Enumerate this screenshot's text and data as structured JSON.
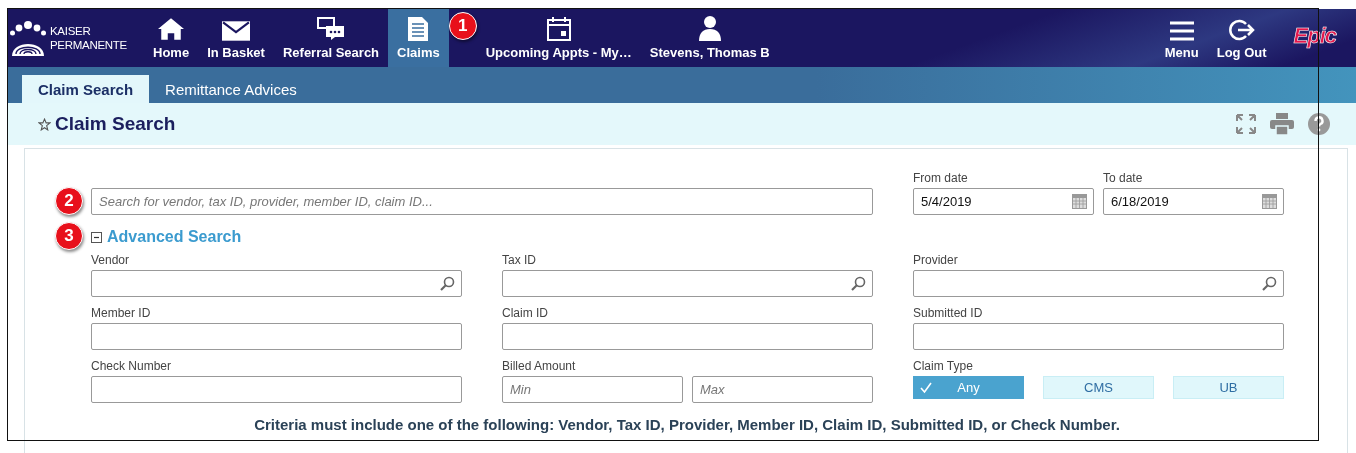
{
  "header": {
    "logo_lines": [
      "KAISER",
      "PERMANENTE"
    ],
    "nav": [
      {
        "label": "Home",
        "selected": false
      },
      {
        "label": "In Basket",
        "selected": false
      },
      {
        "label": "Referral Search",
        "selected": false
      },
      {
        "label": "Claims",
        "selected": true,
        "callout": "1"
      },
      {
        "label": "Upcoming Appts - My…",
        "selected": false
      },
      {
        "label": "Stevens, Thomas B",
        "selected": false
      }
    ],
    "right_items": [
      {
        "label": "Menu"
      },
      {
        "label": "Log Out"
      }
    ],
    "brand": "Epic"
  },
  "subtabs": [
    {
      "label": "Claim Search",
      "selected": true
    },
    {
      "label": "Remittance Advices",
      "selected": false
    }
  ],
  "page_title": "Claim Search",
  "search": {
    "placeholder": "Search for vendor, tax ID, provider, member ID, claim ID...",
    "callout": "2"
  },
  "dates": [
    {
      "label": "From date",
      "value": "5/4/2019"
    },
    {
      "label": "To date",
      "value": "6/18/2019"
    }
  ],
  "advanced": {
    "label": "Advanced Search",
    "expanded": true,
    "callout": "3"
  },
  "fields": [
    {
      "label": "Vendor",
      "kind": "lookup"
    },
    {
      "label": "Tax ID",
      "kind": "lookup"
    },
    {
      "label": "Provider",
      "kind": "lookup"
    },
    {
      "label": "Member ID",
      "kind": "text"
    },
    {
      "label": "Claim ID",
      "kind": "text"
    },
    {
      "label": "Submitted ID",
      "kind": "text"
    },
    {
      "label": "Check Number",
      "kind": "text"
    },
    {
      "label": "Billed Amount",
      "kind": "range",
      "placeholders": [
        "Min",
        "Max"
      ]
    },
    {
      "label": "Claim Type",
      "kind": "toggle",
      "options": [
        {
          "label": "Any",
          "selected": true
        },
        {
          "label": "CMS",
          "selected": false
        },
        {
          "label": "UB",
          "selected": false
        }
      ]
    }
  ],
  "note": "Criteria must include one of the following: Vendor, Tax ID, Provider, Member ID, Claim ID, Submitted ID, or Check Number."
}
